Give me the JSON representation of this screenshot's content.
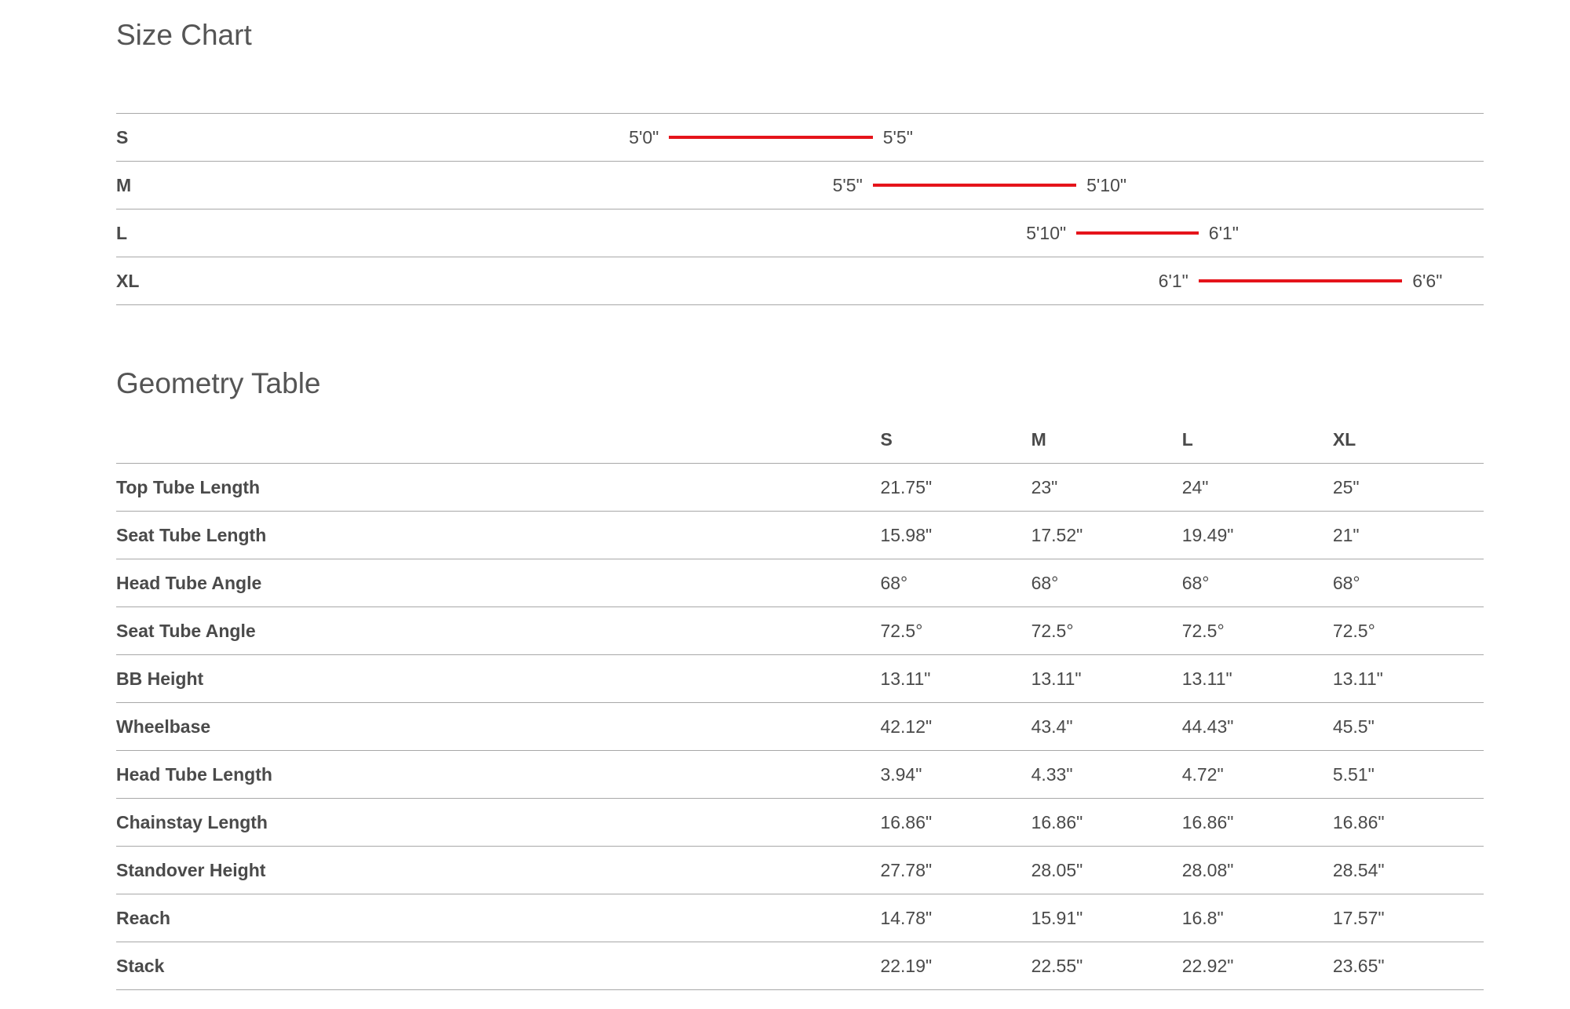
{
  "size_chart": {
    "title": "Size Chart",
    "scale": {
      "min_in": 54,
      "max_in": 80
    },
    "rows": [
      {
        "size": "S",
        "min_label": "5'0\"",
        "max_label": "5'5\"",
        "min_in": 60,
        "max_in": 65
      },
      {
        "size": "M",
        "min_label": "5'5\"",
        "max_label": "5'10\"",
        "min_in": 65,
        "max_in": 70
      },
      {
        "size": "L",
        "min_label": "5'10\"",
        "max_label": "6'1\"",
        "min_in": 70,
        "max_in": 73
      },
      {
        "size": "XL",
        "min_label": "6'1\"",
        "max_label": "6'6\"",
        "min_in": 73,
        "max_in": 78
      }
    ],
    "bar_color": "#e5141b"
  },
  "geometry": {
    "title": "Geometry Table",
    "columns": [
      "S",
      "M",
      "L",
      "XL"
    ],
    "rows": [
      {
        "metric": "Top Tube Length",
        "values": [
          "21.75\"",
          "23\"",
          "24\"",
          "25\""
        ]
      },
      {
        "metric": "Seat Tube Length",
        "values": [
          "15.98\"",
          "17.52\"",
          "19.49\"",
          "21\""
        ]
      },
      {
        "metric": "Head Tube Angle",
        "values": [
          "68°",
          "68°",
          "68°",
          "68°"
        ]
      },
      {
        "metric": "Seat Tube Angle",
        "values": [
          "72.5°",
          "72.5°",
          "72.5°",
          "72.5°"
        ]
      },
      {
        "metric": "BB Height",
        "values": [
          "13.11\"",
          "13.11\"",
          "13.11\"",
          "13.11\""
        ]
      },
      {
        "metric": "Wheelbase",
        "values": [
          "42.12\"",
          "43.4\"",
          "44.43\"",
          "45.5\""
        ]
      },
      {
        "metric": "Head Tube Length",
        "values": [
          "3.94\"",
          "4.33\"",
          "4.72\"",
          "5.51\""
        ]
      },
      {
        "metric": "Chainstay Length",
        "values": [
          "16.86\"",
          "16.86\"",
          "16.86\"",
          "16.86\""
        ]
      },
      {
        "metric": "Standover Height",
        "values": [
          "27.78\"",
          "28.05\"",
          "28.08\"",
          "28.54\""
        ]
      },
      {
        "metric": "Reach",
        "values": [
          "14.78\"",
          "15.91\"",
          "16.8\"",
          "17.57\""
        ]
      },
      {
        "metric": "Stack",
        "values": [
          "22.19\"",
          "22.55\"",
          "22.92\"",
          "23.65\""
        ]
      }
    ]
  }
}
